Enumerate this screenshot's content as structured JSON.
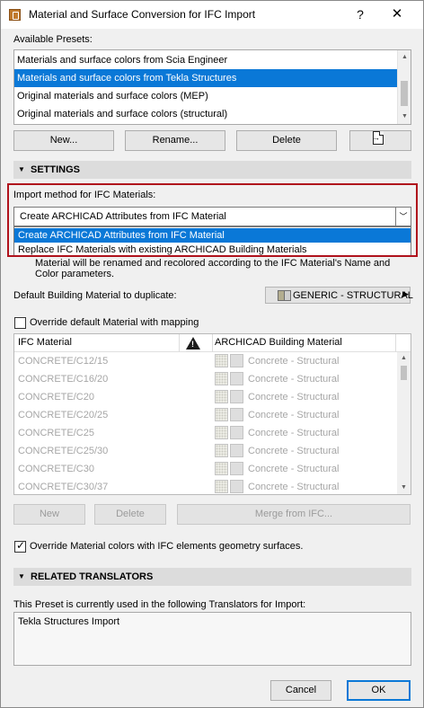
{
  "window": {
    "title": "Material and Surface Conversion for IFC Import",
    "help_glyph": "?",
    "close_glyph": "✕",
    "icon": "archicad-app-icon"
  },
  "presets": {
    "label": "Available Presets:",
    "items": [
      {
        "label": "Materials and surface colors from Scia Engineer",
        "selected": false
      },
      {
        "label": "Materials and surface colors from Tekla Structures",
        "selected": true
      },
      {
        "label": "Original materials and surface colors (MEP)",
        "selected": false
      },
      {
        "label": "Original materials and surface colors (structural)",
        "selected": false
      }
    ],
    "buttons": {
      "new": "New...",
      "rename": "Rename...",
      "delete": "Delete",
      "export_icon": "export-icon"
    }
  },
  "settings": {
    "header": "SETTINGS",
    "import_method_label": "Import method for IFC Materials:",
    "import_method_value": "Create ARCHICAD Attributes from IFC Material",
    "import_method_options": [
      {
        "label": "Create ARCHICAD Attributes from IFC Material",
        "selected": true
      },
      {
        "label": "Replace IFC Materials with existing ARCHICAD Building Materials",
        "selected": false
      }
    ],
    "note_line1": "Material will be renamed and recolored according to the IFC Material's Name and",
    "note_line2": "Color parameters.",
    "default_material_label": "Default Building Material to duplicate:",
    "default_material_value": "GENERIC - STRUCTURAL",
    "override_mapping_label": "Override default Material with mapping",
    "override_mapping_checked": false,
    "table": {
      "col_ifc": "IFC Material",
      "col_archicad": "ARCHICAD Building Material",
      "warning_icon": "warning-icon",
      "rows": [
        {
          "ifc": "CONCRETE/C12/15",
          "archicad": "Concrete - Structural"
        },
        {
          "ifc": "CONCRETE/C16/20",
          "archicad": "Concrete - Structural"
        },
        {
          "ifc": "CONCRETE/C20",
          "archicad": "Concrete - Structural"
        },
        {
          "ifc": "CONCRETE/C20/25",
          "archicad": "Concrete - Structural"
        },
        {
          "ifc": "CONCRETE/C25",
          "archicad": "Concrete - Structural"
        },
        {
          "ifc": "CONCRETE/C25/30",
          "archicad": "Concrete - Structural"
        },
        {
          "ifc": "CONCRETE/C30",
          "archicad": "Concrete - Structural"
        },
        {
          "ifc": "CONCRETE/C30/37",
          "archicad": "Concrete - Structural"
        }
      ]
    },
    "table_buttons": {
      "new": "New",
      "delete": "Delete",
      "merge": "Merge from IFC..."
    },
    "override_colors_label": "Override Material colors with IFC elements geometry surfaces.",
    "override_colors_checked": true
  },
  "related": {
    "header": "RELATED TRANSLATORS",
    "info": "This Preset is currently used in the following Translators for Import:",
    "translators": "Tekla Structures Import"
  },
  "footer": {
    "cancel": "Cancel",
    "ok": "OK"
  },
  "colors": {
    "accent": "#0a78d7",
    "highlight_border": "#b0121c",
    "section_bg": "#dcdcdc",
    "dialog_bg": "#f0f0f0"
  }
}
